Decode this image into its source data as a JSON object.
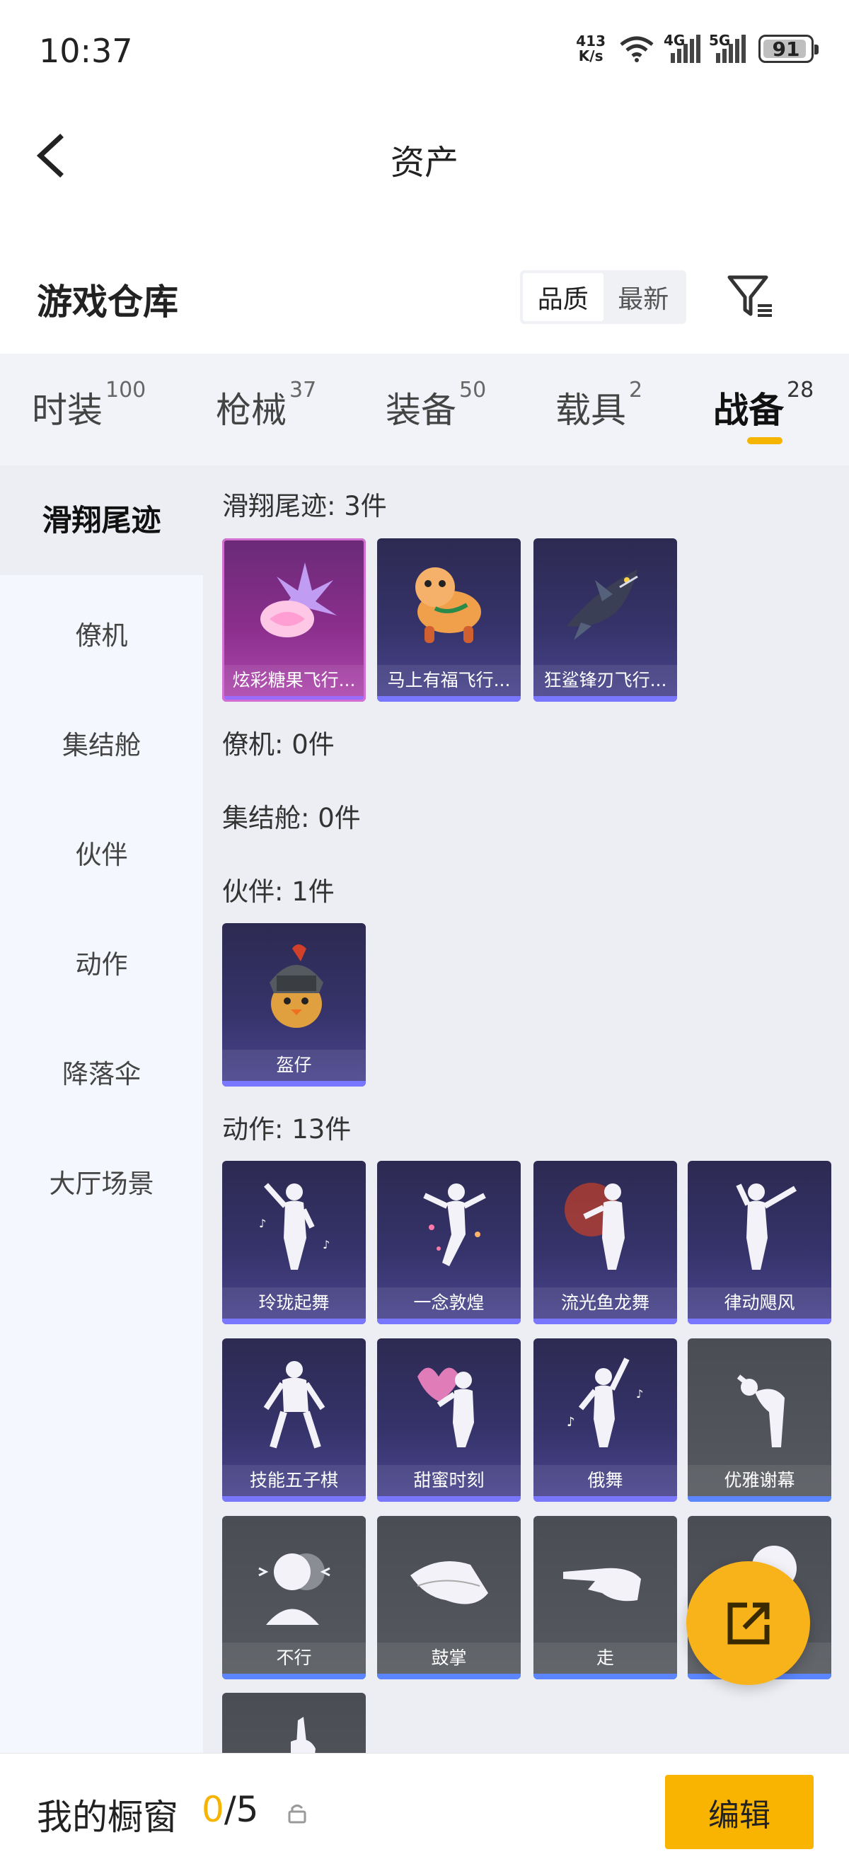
{
  "status": {
    "time": "10:37",
    "net_speed_top": "413",
    "net_speed_bottom": "K/s",
    "sig1": "4G",
    "sig2": "5G",
    "battery": "91",
    "battery_level": 0.91
  },
  "nav": {
    "title": "资产",
    "back_icon": "chevron-left-icon"
  },
  "header": {
    "title": "游戏仓库",
    "sort_options": [
      "品质",
      "最新"
    ],
    "sort_selected": "品质",
    "filter_icon": "filter-icon"
  },
  "tabs": [
    {
      "label": "时装",
      "count": "100"
    },
    {
      "label": "枪械",
      "count": "37"
    },
    {
      "label": "装备",
      "count": "50"
    },
    {
      "label": "载具",
      "count": "2"
    },
    {
      "label": "战备",
      "count": "28"
    }
  ],
  "active_tab": "战备",
  "accent_color": "#f5b400",
  "sidebar": [
    "滑翔尾迹",
    "僚机",
    "集结舱",
    "伙伴",
    "动作",
    "降落伞",
    "大厅场景"
  ],
  "sections": [
    {
      "title": "滑翔尾迹: 3件",
      "items": [
        "炫彩糖果飞行...",
        "马上有福飞行...",
        "狂鲨锋刃飞行..."
      ]
    },
    {
      "title": "僚机: 0件",
      "items": []
    },
    {
      "title": "集结舱: 0件",
      "items": []
    },
    {
      "title": "伙伴: 1件",
      "items": [
        "盔仔"
      ]
    },
    {
      "title": "动作: 13件",
      "items": [
        "玲珑起舞",
        "一念敦煌",
        "流光鱼龙舞",
        "律动飓风",
        "技能五子棋",
        "甜蜜时刻",
        "俄舞",
        "优雅谢幕",
        "不行",
        "鼓掌",
        "走",
        ""
      ]
    }
  ],
  "bottom": {
    "title": "我的橱窗",
    "count_current": "0",
    "count_total": "/5",
    "edit_label": "编辑",
    "lock_icon": "lock-icon"
  },
  "fab_icon": "share-external-icon"
}
